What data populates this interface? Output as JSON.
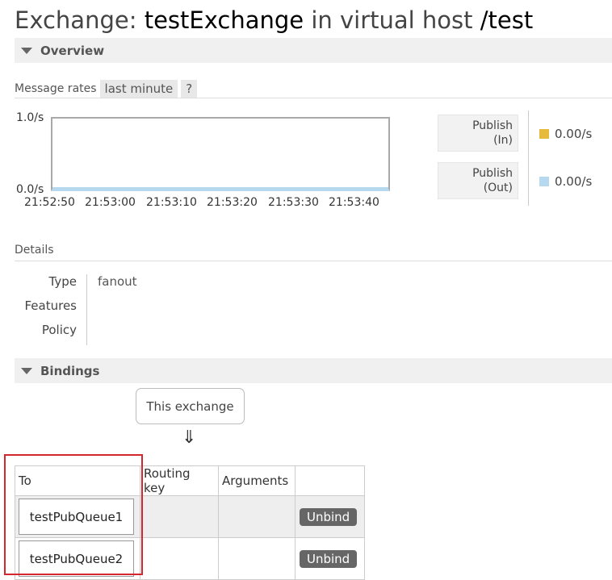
{
  "header": {
    "prefix": "Exchange:",
    "exchange_name": "testExchange",
    "middle": "in virtual host",
    "vhost": "/test"
  },
  "overview": {
    "section_label": "Overview",
    "message_rates_label": "Message rates",
    "range_label": "last minute",
    "help_label": "?"
  },
  "chart_data": {
    "type": "line",
    "x": [
      "21:52:50",
      "21:53:00",
      "21:53:10",
      "21:53:20",
      "21:53:30",
      "21:53:40"
    ],
    "y_ticks": [
      "1.0/s",
      "0.0/s"
    ],
    "ylim": [
      0,
      1.0
    ],
    "series": [
      {
        "name": "Publish (In)",
        "values": [
          0,
          0,
          0,
          0,
          0,
          0
        ],
        "color": "#e6bb3b"
      },
      {
        "name": "Publish (Out)",
        "values": [
          0,
          0,
          0,
          0,
          0,
          0
        ],
        "color": "#b7d9f0"
      }
    ]
  },
  "legend": [
    {
      "label_line1": "Publish",
      "label_line2": "(In)",
      "value": "0.00/s",
      "color": "#e6bb3b"
    },
    {
      "label_line1": "Publish",
      "label_line2": "(Out)",
      "value": "0.00/s",
      "color": "#b7d9f0"
    }
  ],
  "details": {
    "heading": "Details",
    "rows": [
      {
        "label": "Type",
        "value": "fanout"
      },
      {
        "label": "Features",
        "value": ""
      },
      {
        "label": "Policy",
        "value": ""
      }
    ]
  },
  "bindings": {
    "section_label": "Bindings",
    "source_label": "This exchange",
    "arrow": "⇓",
    "columns": [
      "To",
      "Routing key",
      "Arguments",
      ""
    ],
    "rows": [
      {
        "to": "testPubQueue1",
        "routing_key": "",
        "arguments": "",
        "action": "Unbind"
      },
      {
        "to": "testPubQueue2",
        "routing_key": "",
        "arguments": "",
        "action": "Unbind"
      }
    ]
  }
}
